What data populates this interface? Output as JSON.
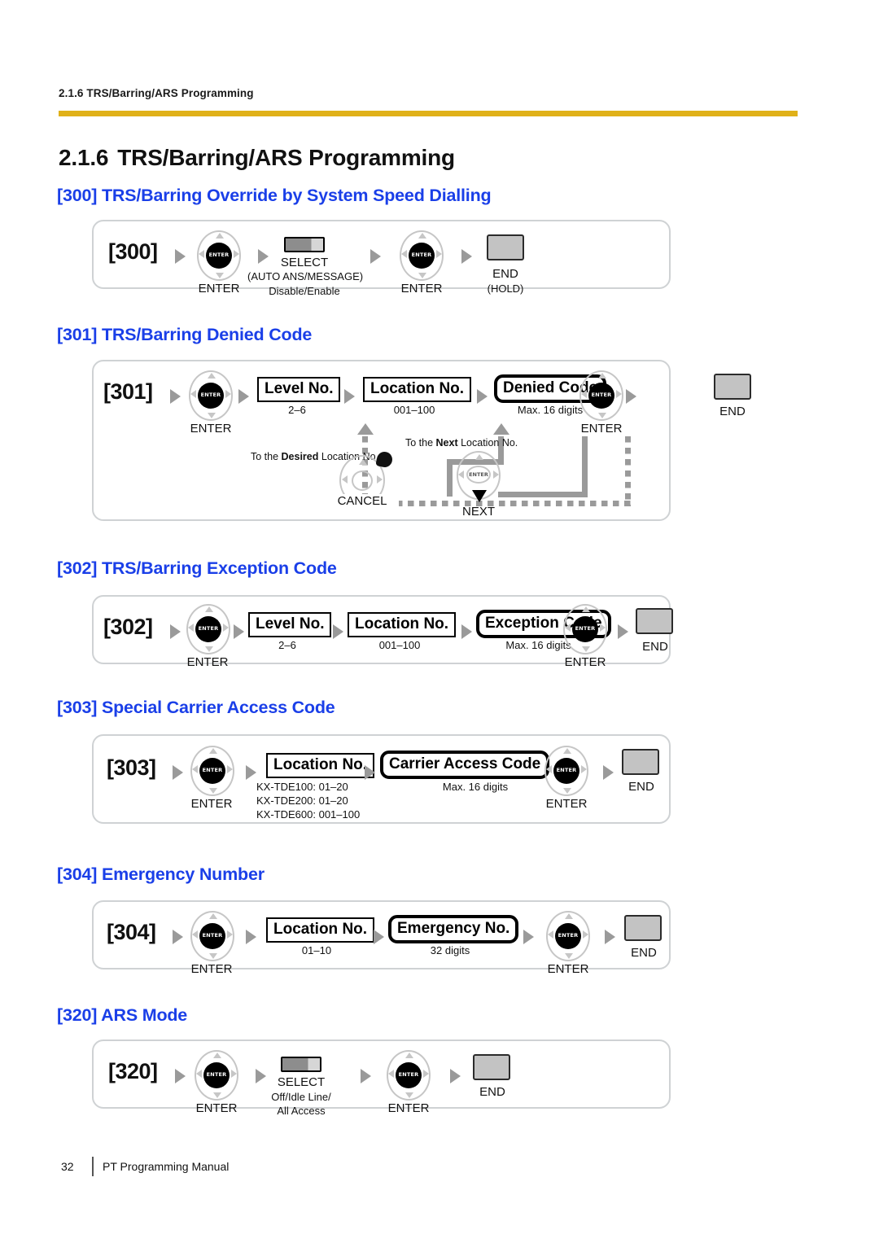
{
  "header": {
    "running_head": "2.1.6 TRS/Barring/ARS Programming",
    "rule_color": "#e0b119"
  },
  "title": {
    "number": "2.1.6",
    "text": "TRS/Barring/ARS Programming"
  },
  "heading_color": "#1a3fe8",
  "sections": [
    {
      "heading": "[300] TRS/Barring Override by System Speed Dialling",
      "code": "[300]",
      "steps": {
        "enter1_label": "ENTER",
        "enter1_key": "ENTER",
        "select_label": "SELECT",
        "select_sub1": "(AUTO ANS/MESSAGE)",
        "select_sub2": "Disable/Enable",
        "enter2_label": "ENTER",
        "enter2_key": "ENTER",
        "end_label": "END",
        "end_sub": "(HOLD)"
      }
    },
    {
      "heading": "[301] TRS/Barring Denied Code",
      "code": "[301]",
      "steps": {
        "enter1_label": "ENTER",
        "enter1_key": "ENTER",
        "box1": "Level No.",
        "box1_sub": "2–6",
        "box2": "Location No.",
        "box2_sub": "001–100",
        "box3": "Denied Code",
        "box3_sub": "Max. 16 digits",
        "enter2_label": "ENTER",
        "enter2_key": "ENTER",
        "end_label": "END"
      },
      "loop": {
        "desired_prefix": "To the ",
        "desired_bold": "Desired",
        "desired_suffix": " Location No.",
        "next_prefix": "To the ",
        "next_bold": "Next",
        "next_suffix": " Location No.",
        "cancel_label": "CANCEL",
        "next_label": "NEXT",
        "next_key": "ENTER"
      }
    },
    {
      "heading": "[302] TRS/Barring Exception Code",
      "code": "[302]",
      "steps": {
        "enter1_label": "ENTER",
        "enter1_key": "ENTER",
        "box1": "Level No.",
        "box1_sub": "2–6",
        "box2": "Location No.",
        "box2_sub": "001–100",
        "box3": "Exception Code",
        "box3_sub": "Max. 16 digits",
        "enter2_label": "ENTER",
        "enter2_key": "ENTER",
        "end_label": "END"
      }
    },
    {
      "heading": "[303] Special Carrier Access Code",
      "code": "[303]",
      "steps": {
        "enter1_label": "ENTER",
        "enter1_key": "ENTER",
        "box1": "Location No.",
        "box1_sub_line1": "KX-TDE100: 01–20",
        "box1_sub_line2": "KX-TDE200: 01–20",
        "box1_sub_line3": "KX-TDE600: 001–100",
        "box2": "Carrier Access Code",
        "box2_sub": "Max. 16 digits",
        "enter2_label": "ENTER",
        "enter2_key": "ENTER",
        "end_label": "END"
      }
    },
    {
      "heading": "[304] Emergency Number",
      "code": "[304]",
      "steps": {
        "enter1_label": "ENTER",
        "enter1_key": "ENTER",
        "box1": "Location No.",
        "box1_sub": "01–10",
        "box2": "Emergency No.",
        "box2_sub": "32 digits",
        "enter2_label": "ENTER",
        "enter2_key": "ENTER",
        "end_label": "END"
      }
    },
    {
      "heading": "[320] ARS Mode",
      "code": "[320]",
      "steps": {
        "enter1_label": "ENTER",
        "enter1_key": "ENTER",
        "select_label": "SELECT",
        "select_sub1": "Off/Idle Line/",
        "select_sub2": "All Access",
        "enter2_label": "ENTER",
        "enter2_key": "ENTER",
        "end_label": "END"
      }
    }
  ],
  "footer": {
    "page_number": "32",
    "manual": "PT Programming Manual"
  }
}
